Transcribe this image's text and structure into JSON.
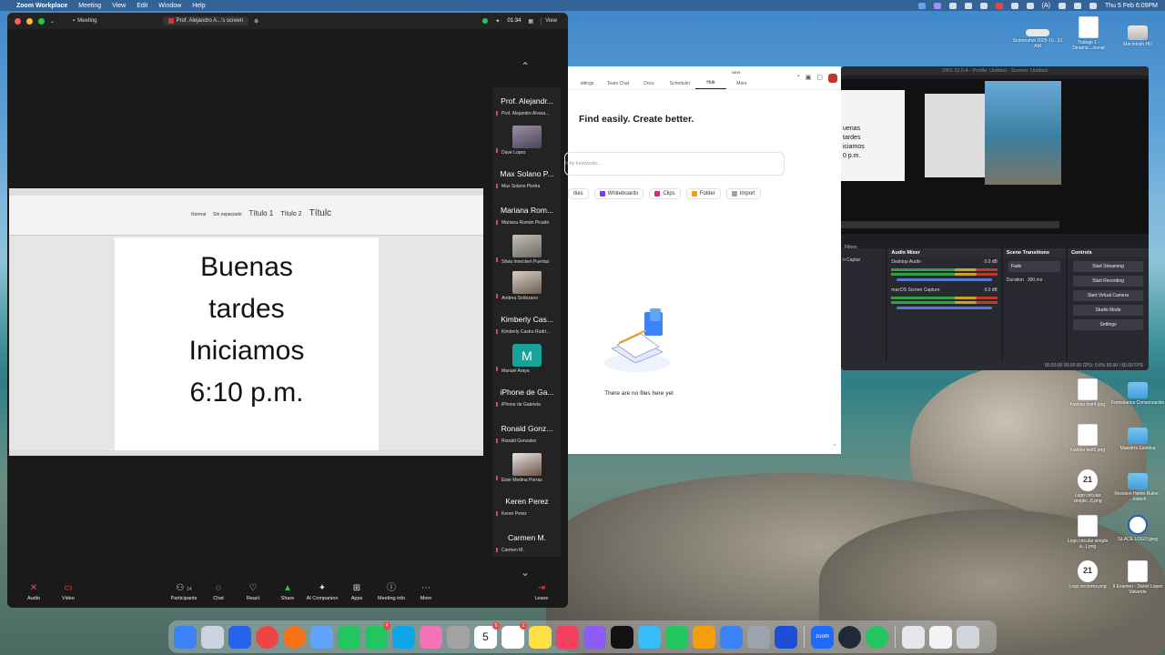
{
  "menubar": {
    "app": "Zoom Workplace",
    "menus": [
      "Meeting",
      "View",
      "Edit",
      "Window",
      "Help"
    ],
    "right_text": "(A)",
    "clock": "Thu 5 Feb 6:09PM"
  },
  "zoom": {
    "tab1": "Meeting",
    "tab2": "Prof. Alejandro A...'s screen",
    "timer": "01:34",
    "view": "View",
    "shared_slide": {
      "lines": [
        "Buenas",
        "tardes",
        "Iniciamos",
        "6:10 p.m."
      ],
      "ribbon_styles": [
        "Normal",
        "Sin espaciado",
        "Título 1",
        "Título 2",
        "Títulc"
      ]
    },
    "participants": [
      {
        "kind": "name",
        "name": "Prof. Alejandr...",
        "sub": "Prof. Alejandro Alvara..."
      },
      {
        "kind": "video",
        "sub": "Dave Lopez"
      },
      {
        "kind": "name",
        "name": "Max Solano P...",
        "sub": "Max Solano Piedra"
      },
      {
        "kind": "name",
        "name": "Mariana Rom...",
        "sub": "Mariana Román Picado"
      },
      {
        "kind": "video",
        "sub": "Silvia Innecken Puertas"
      },
      {
        "kind": "video",
        "sub": "Andrea Solórzano"
      },
      {
        "kind": "name",
        "name": "Kimberly Cas...",
        "sub": "Kimberly Castro Rodrí..."
      },
      {
        "kind": "avatar",
        "letter": "M",
        "sub": "Manuel Araya"
      },
      {
        "kind": "name",
        "name": "iPhone de Ga...",
        "sub": "iPhone de Gabriela"
      },
      {
        "kind": "name",
        "name": "Ronald Gonz...",
        "sub": "Ronald Gonzalez"
      },
      {
        "kind": "video",
        "sub": "Elsie Medina Porras"
      },
      {
        "kind": "name",
        "name": "Keren Perez",
        "sub": "Keren Perez"
      },
      {
        "kind": "name",
        "name": "Carmen M.",
        "sub": "Carmen M."
      }
    ],
    "toolbar": {
      "audio": "Audio",
      "video": "Video",
      "participants": "Participants",
      "participants_count": "14",
      "chat": "Chat",
      "react": "React",
      "share": "Share",
      "ai": "AI Companion",
      "apps": "Apps",
      "info": "Meeting info",
      "more": "More",
      "leave": "Leave"
    }
  },
  "filewin": {
    "tabs": [
      "ettings",
      "Team Chat",
      "Docs",
      "Scheduler",
      "Hub",
      "More"
    ],
    "new_badge": "NEW",
    "heading": "Find easily. Create better.",
    "search_placeholder": "h by keywords...",
    "chips": [
      "ities",
      "Whiteboards",
      "Clips",
      "Folder",
      "Import"
    ],
    "empty": "There are no files here yet"
  },
  "obs": {
    "title": "OBS 32.0.4 - Profile: Untitled - Scenes: Untitled",
    "preview_lines": [
      "uenas",
      "tardes",
      "iciamos",
      "0 p.m."
    ],
    "filters": "Filters",
    "capture": "n Captur",
    "audio_mixer": "Audio Mixer",
    "desktop_audio": "Desktop Audio",
    "screen_capture": "macOS Screen Capture",
    "db1": "0.0 dB",
    "db2": "0.0 dB",
    "scene_transitions": "Scene Transitions",
    "fade": "Fade",
    "duration_label": "Duration",
    "duration_value": "300 ms",
    "controls": "Controls",
    "buttons": [
      "Start Streaming",
      "Start Recording",
      "Start Virtual Camera",
      "Studio Mode",
      "Settings"
    ],
    "status": "00:00:00   00:00:00   CPU: 0.6%   60.00 / 60.00 FPS"
  },
  "desktop_icons": [
    {
      "label": "Screenshot 2025-10...31 AM",
      "kind": "shot"
    },
    {
      "label": "Trabajo 1 - Dinamic...cional",
      "kind": "doc"
    },
    {
      "label": "Macintosh HD",
      "kind": "hd"
    },
    {
      "label": "Ivannia test4.png",
      "kind": "bluedoc"
    },
    {
      "label": "Formularios Conversación",
      "kind": "folder"
    },
    {
      "label": "Ivannia test5.png",
      "kind": "bluedoc"
    },
    {
      "label": "Maestría Estética",
      "kind": "folder"
    },
    {
      "label": "Logo circular simple...6.png",
      "kind": "badge"
    },
    {
      "label": "Revision Hemo Rules - ...nstech",
      "kind": "folder"
    },
    {
      "label": "Logo circular simple a...).png",
      "kind": "bluedoc"
    },
    {
      "label": "GLACE LOGO.jpeg",
      "kind": "logo"
    },
    {
      "label": "Logo vectores.png",
      "kind": "badge"
    },
    {
      "label": "II Examen - Dariel Lopez Valverde",
      "kind": "doc"
    }
  ],
  "dock": {
    "badges": {
      "messages": "4",
      "calendar": "5",
      "reminders": "1"
    },
    "calendar_day": "5",
    "zoom_label": "zoom"
  }
}
